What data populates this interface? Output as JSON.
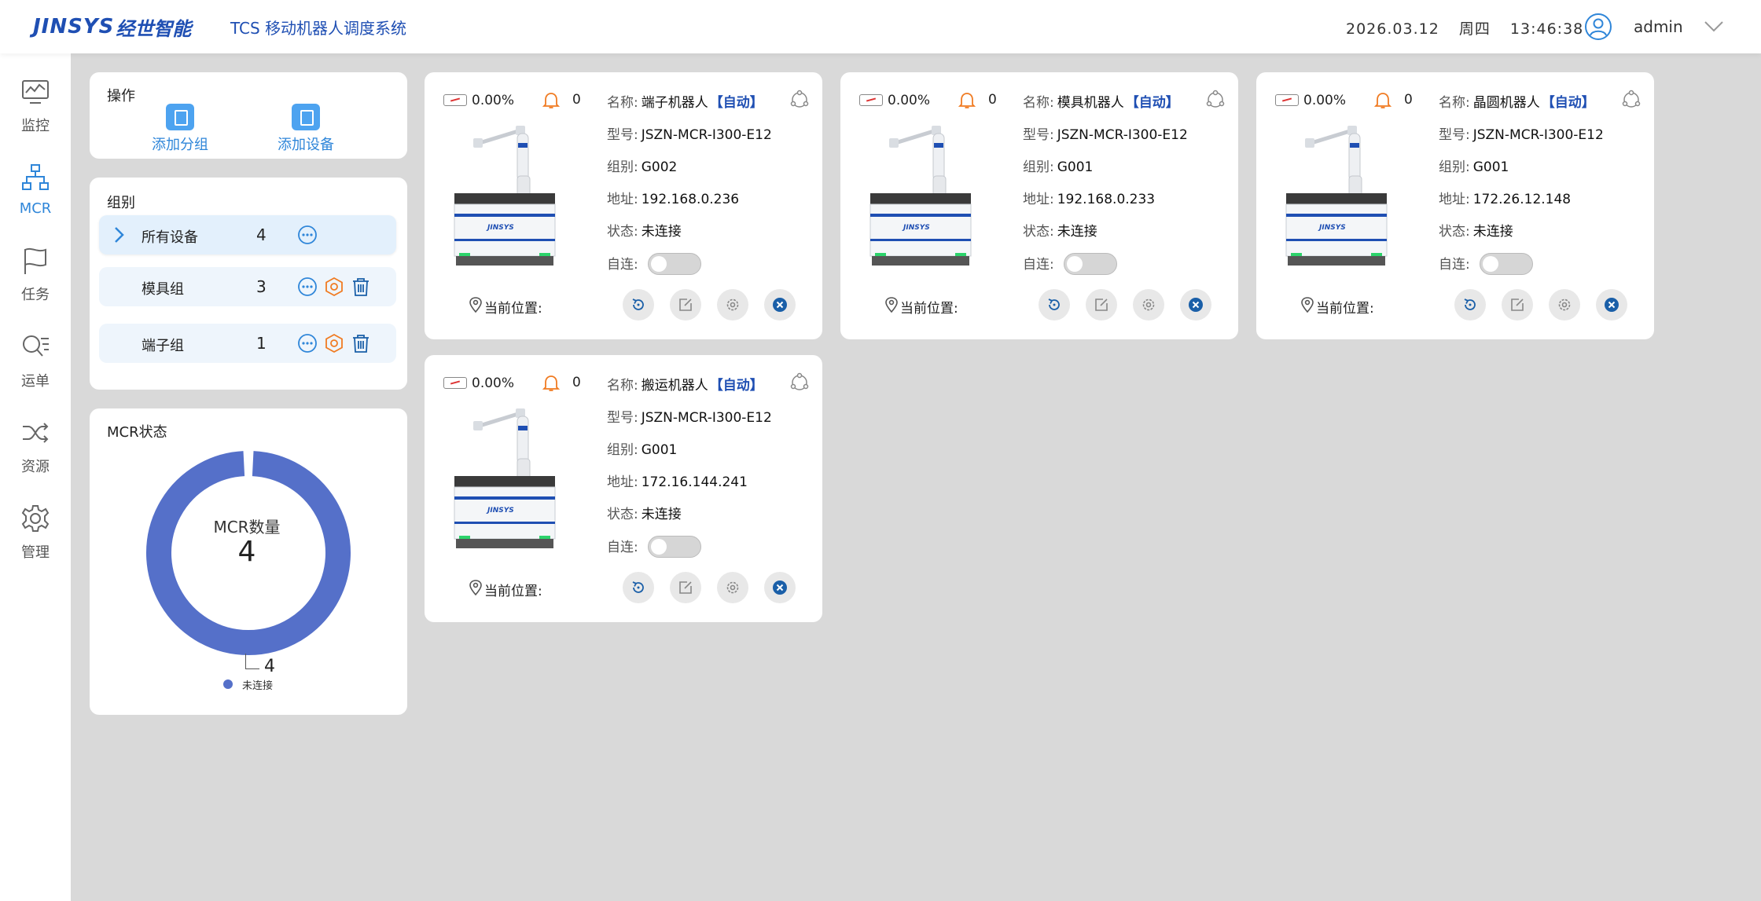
{
  "header": {
    "logo_en": "JINSYS",
    "logo_cn": "经世智能",
    "title": "TCS 移动机器人调度系统",
    "date": "2026.03.12",
    "weekday": "周四",
    "time": "13:46:38",
    "username": "admin"
  },
  "sidebar": {
    "items": [
      {
        "label": "监控",
        "icon": "monitor-icon"
      },
      {
        "label": "MCR",
        "icon": "network-icon"
      },
      {
        "label": "任务",
        "icon": "flag-icon"
      },
      {
        "label": "运单",
        "icon": "search-list-icon"
      },
      {
        "label": "资源",
        "icon": "shuffle-icon"
      },
      {
        "label": "管理",
        "icon": "gear-icon"
      }
    ],
    "active": "MCR"
  },
  "operations": {
    "title": "操作",
    "add_group": "添加分组",
    "add_device": "添加设备"
  },
  "groups": {
    "title": "组别",
    "rows": [
      {
        "name": "所有设备",
        "count": "4"
      },
      {
        "name": "模具组",
        "count": "3"
      },
      {
        "name": "端子组",
        "count": "1"
      }
    ]
  },
  "mcr_status": {
    "title": "MCR状态",
    "center_label": "MCR数量",
    "center_value": "4",
    "slice_value": "4",
    "legend": "未连接",
    "color": "#5570c9"
  },
  "robot_labels": {
    "name": "名称:",
    "model": "型号:",
    "group": "组别:",
    "address": "地址:",
    "status": "状态:",
    "auto_connect": "自连:",
    "location": "当前位置:"
  },
  "robots": [
    {
      "battery": "0.00%",
      "alarms": "0",
      "name": "端子机器人",
      "mode": "【自动】",
      "model": "JSZN-MCR-I300-E12",
      "group": "G002",
      "address": "192.168.0.236",
      "status": "未连接"
    },
    {
      "battery": "0.00%",
      "alarms": "0",
      "name": "模具机器人",
      "mode": "【自动】",
      "model": "JSZN-MCR-I300-E12",
      "group": "G001",
      "address": "192.168.0.233",
      "status": "未连接"
    },
    {
      "battery": "0.00%",
      "alarms": "0",
      "name": "晶圆机器人",
      "mode": "【自动】",
      "model": "JSZN-MCR-I300-E12",
      "group": "G001",
      "address": "172.26.12.148",
      "status": "未连接"
    },
    {
      "battery": "0.00%",
      "alarms": "0",
      "name": "搬运机器人",
      "mode": "【自动】",
      "model": "JSZN-MCR-I300-E12",
      "group": "G001",
      "address": "172.16.144.241",
      "status": "未连接"
    }
  ],
  "colors": {
    "brand": "#1f4fb3",
    "accent": "#2f86d9",
    "alarm": "#f07b22",
    "close": "#1a5fa8"
  }
}
